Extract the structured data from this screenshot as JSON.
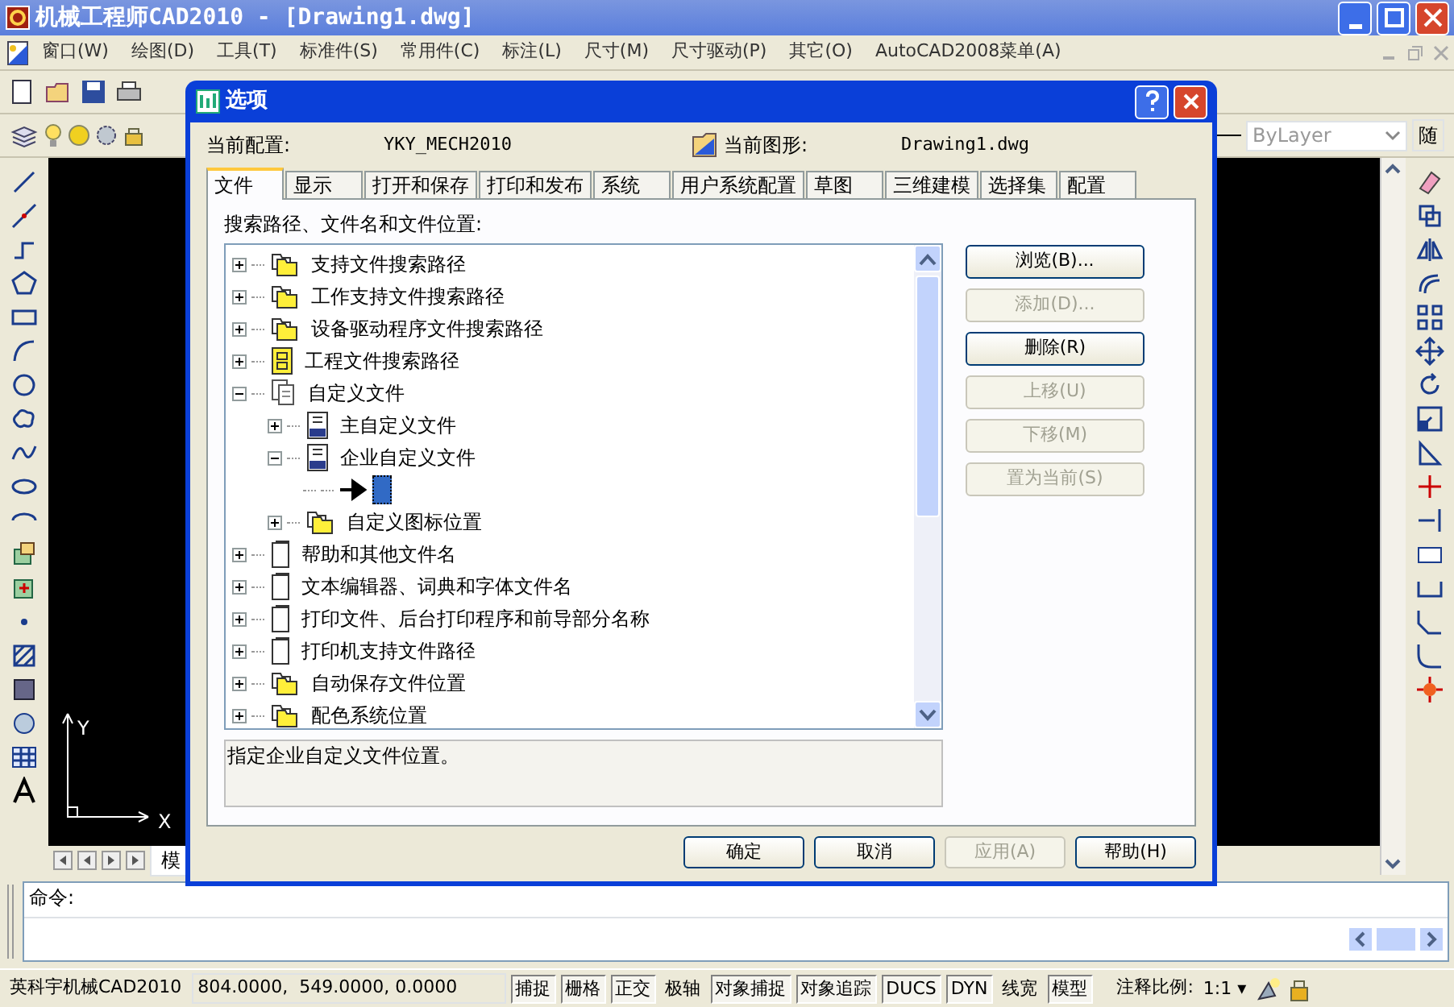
{
  "window": {
    "title": "机械工程师CAD2010 - [Drawing1.dwg]"
  },
  "menu": [
    "窗口(W)",
    "绘图(D)",
    "工具(T)",
    "标准件(S)",
    "常用件(C)",
    "标注(L)",
    "尺寸(M)",
    "尺寸驱动(P)",
    "其它(O)",
    "AutoCAD2008菜单(A)"
  ],
  "toolbar": {
    "linetype_dropdown": "ByLayer",
    "cut_label": "随"
  },
  "canvas": {
    "axis_y": "Y",
    "axis_x": "X",
    "layout_tab": "模"
  },
  "dialog": {
    "title": "选项",
    "profile_label": "当前配置:",
    "profile": "YKY_MECH2010",
    "drawing_label": "当前图形:",
    "drawing": "Drawing1.dwg",
    "tabs": [
      {
        "label": "文件",
        "selected": true
      },
      {
        "label": "显示",
        "selected": false
      },
      {
        "label": "打开和保存",
        "selected": false
      },
      {
        "label": "打印和发布",
        "selected": false
      },
      {
        "label": "系统",
        "selected": false
      },
      {
        "label": "用户系统配置",
        "selected": false
      },
      {
        "label": "草图",
        "selected": false
      },
      {
        "label": "三维建模",
        "selected": false
      },
      {
        "label": "选择集",
        "selected": false
      },
      {
        "label": "配置",
        "selected": false
      }
    ],
    "tree_label": "搜索路径、文件名和文件位置:",
    "tree": [
      {
        "label": "支持文件搜索路径",
        "kind": "folder",
        "expanded": false,
        "selected": false
      },
      {
        "label": "工作支持文件搜索路径",
        "kind": "folder",
        "expanded": false,
        "selected": false
      },
      {
        "label": "设备驱动程序文件搜索路径",
        "kind": "folder",
        "expanded": false,
        "selected": false
      },
      {
        "label": "工程文件搜索路径",
        "kind": "project",
        "expanded": false,
        "selected": false
      },
      {
        "label": "自定义文件",
        "kind": "files",
        "expanded": true,
        "selected": false,
        "children": [
          {
            "label": "主自定义文件",
            "kind": "cui",
            "expanded": false,
            "selected": false
          },
          {
            "label": "企业自定义文件",
            "kind": "cui",
            "expanded": true,
            "selected": false,
            "children": [
              {
                "kind": "path",
                "selected": true
              }
            ]
          },
          {
            "label": "自定义图标位置",
            "kind": "folder",
            "expanded": false,
            "selected": false
          }
        ]
      },
      {
        "label": "帮助和其他文件名",
        "kind": "file",
        "expanded": false,
        "selected": false
      },
      {
        "label": "文本编辑器、词典和字体文件名",
        "kind": "file",
        "expanded": false,
        "selected": false
      },
      {
        "label": "打印文件、后台打印程序和前导部分名称",
        "kind": "file",
        "expanded": false,
        "selected": false
      },
      {
        "label": "打印机支持文件路径",
        "kind": "file",
        "expanded": false,
        "selected": false
      },
      {
        "label": "自动保存文件位置",
        "kind": "folder",
        "expanded": false,
        "selected": false
      },
      {
        "label": "配色系统位置",
        "kind": "folder",
        "expanded": false,
        "selected": false
      }
    ],
    "description": "指定企业自定义文件位置。",
    "side_buttons": [
      {
        "label": "浏览(B)...",
        "disabled": false
      },
      {
        "label": "添加(D)...",
        "disabled": true
      },
      {
        "label": "删除(R)",
        "disabled": false
      },
      {
        "label": "上移(U)",
        "disabled": true
      },
      {
        "label": "下移(M)",
        "disabled": true
      },
      {
        "label": "置为当前(S)",
        "disabled": true
      }
    ],
    "footer_buttons": [
      {
        "label": "确定",
        "disabled": false
      },
      {
        "label": "取消",
        "disabled": false
      },
      {
        "label": "应用(A)",
        "disabled": true
      },
      {
        "label": "帮助(H)",
        "disabled": false
      }
    ]
  },
  "command": {
    "prompt": "命令:"
  },
  "status_bar": {
    "app": "英科宇机械CAD2010",
    "coords": "804.0000,  549.0000, 0.0000",
    "toggles": [
      {
        "label": "捕捉",
        "on": true
      },
      {
        "label": "栅格",
        "on": true
      },
      {
        "label": "正交",
        "on": true
      },
      {
        "label": "极轴",
        "on": false
      },
      {
        "label": "对象捕捉",
        "on": true
      },
      {
        "label": "对象追踪",
        "on": true
      },
      {
        "label": "DUCS",
        "on": true
      },
      {
        "label": "DYN",
        "on": true
      },
      {
        "label": "线宽",
        "on": false
      },
      {
        "label": "模型",
        "on": true
      }
    ],
    "scale_label": "注释比例:",
    "scale": "1:1 ▾"
  }
}
